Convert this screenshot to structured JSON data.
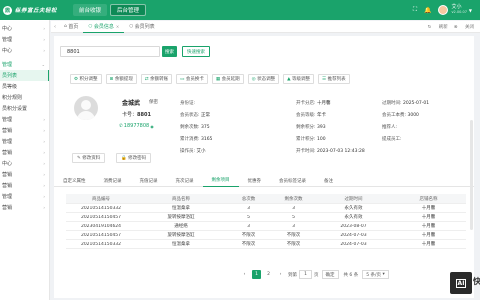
{
  "app": {
    "logo_mark": "鼎",
    "logo_text": "纵券富丘夫轻松",
    "top_tabs": [
      {
        "label": "前台收银"
      },
      {
        "label": "后台管理"
      }
    ],
    "user_name": "艾小",
    "user_sub": "v2.00.07"
  },
  "sidebar": {
    "items": [
      {
        "label": "中心"
      },
      {
        "label": "管理"
      },
      {
        "label": "中心"
      },
      {
        "label": "管理"
      },
      {
        "label": "员列表"
      },
      {
        "label": "员等级"
      },
      {
        "label": "积分规则"
      },
      {
        "label": "员积分设置"
      },
      {
        "label": "管理"
      },
      {
        "label": "营销"
      },
      {
        "label": "管理"
      },
      {
        "label": "营销"
      },
      {
        "label": "中心"
      },
      {
        "label": "营销"
      },
      {
        "label": "营销"
      },
      {
        "label": "管理"
      },
      {
        "label": "营销"
      }
    ]
  },
  "tabstrip": {
    "tabs": [
      {
        "label": "首页"
      },
      {
        "label": "会员信息"
      },
      {
        "label": "会员列表"
      }
    ],
    "refresh": "刷新",
    "close": "关闭"
  },
  "search": {
    "value": "8801",
    "button": "搜索",
    "quick_button": "快速搜索"
  },
  "actions": [
    {
      "label": "积分调整"
    },
    {
      "label": "余额提现"
    },
    {
      "label": "余额转账"
    },
    {
      "label": "会员换卡"
    },
    {
      "label": "会员延期"
    },
    {
      "label": "状态调整"
    },
    {
      "label": "等级调整"
    },
    {
      "label": "推荐列表"
    }
  ],
  "member": {
    "name": "金城武",
    "tag": "保密",
    "card_label": "卡号：",
    "card_no": "8801",
    "phone": "18977808",
    "edit_info": "修改资料",
    "edit_pwd": "修改密码",
    "fields": [
      {
        "k": "身份证:",
        "v": ""
      },
      {
        "k": "开卡分店:",
        "v": "十月馨"
      },
      {
        "k": "过期时间:",
        "v": "2025-07-01"
      },
      {
        "k": "会员状态:",
        "v": "正常"
      },
      {
        "k": "会员等级:",
        "v": "年卡"
      },
      {
        "k": "会员工本费:",
        "v": "3000"
      },
      {
        "k": "剩余次数:",
        "v": "375"
      },
      {
        "k": "剩余积分:",
        "v": "393"
      },
      {
        "k": "推荐人:",
        "v": ""
      },
      {
        "k": "累计消费:",
        "v": "3165"
      },
      {
        "k": "累计积分:",
        "v": "100"
      },
      {
        "k": "提成员工:",
        "v": ""
      },
      {
        "k": "操作员:",
        "v": "艾小"
      },
      {
        "k": "开卡时间:",
        "v": "2023-07-03 12:43:28"
      }
    ]
  },
  "subtabs": [
    {
      "label": "自定义属性"
    },
    {
      "label": "消费记录"
    },
    {
      "label": "充值记录"
    },
    {
      "label": "充次记录"
    },
    {
      "label": "剩余项目"
    },
    {
      "label": "优惠券"
    },
    {
      "label": "会员标签记录"
    },
    {
      "label": "备注"
    }
  ],
  "table": {
    "headers": [
      "商品编号",
      "商品名称",
      "总次数",
      "剩余次数",
      "过期时间",
      "店铺名称"
    ],
    "rows": [
      [
        "20210514150332",
        "恒温桑拿",
        "3",
        "3",
        "永久有效",
        "十月馨"
      ],
      [
        "20210514150457",
        "旋转按摩浴缸",
        "5",
        "5",
        "永久有效",
        "十月馨"
      ],
      [
        "20230419104624",
        "通经络",
        "3",
        "3",
        "2023-08-07",
        "十月馨"
      ],
      [
        "20210514150457",
        "旋转按摩浴缸",
        "不限次",
        "不限次",
        "2024-07-03",
        "十月馨"
      ],
      [
        "20210514150332",
        "恒温桑拿",
        "不限次",
        "不限次",
        "2024-07-03",
        "十月馨"
      ]
    ]
  },
  "pager": {
    "pages": [
      "1",
      "2"
    ],
    "goto_label": "到第",
    "goto_value": "1",
    "page_unit": "页",
    "confirm": "确定",
    "total": "共 6 条",
    "page_size": "5 条/页"
  },
  "badge": {
    "label": "AI",
    "edge": "快"
  }
}
